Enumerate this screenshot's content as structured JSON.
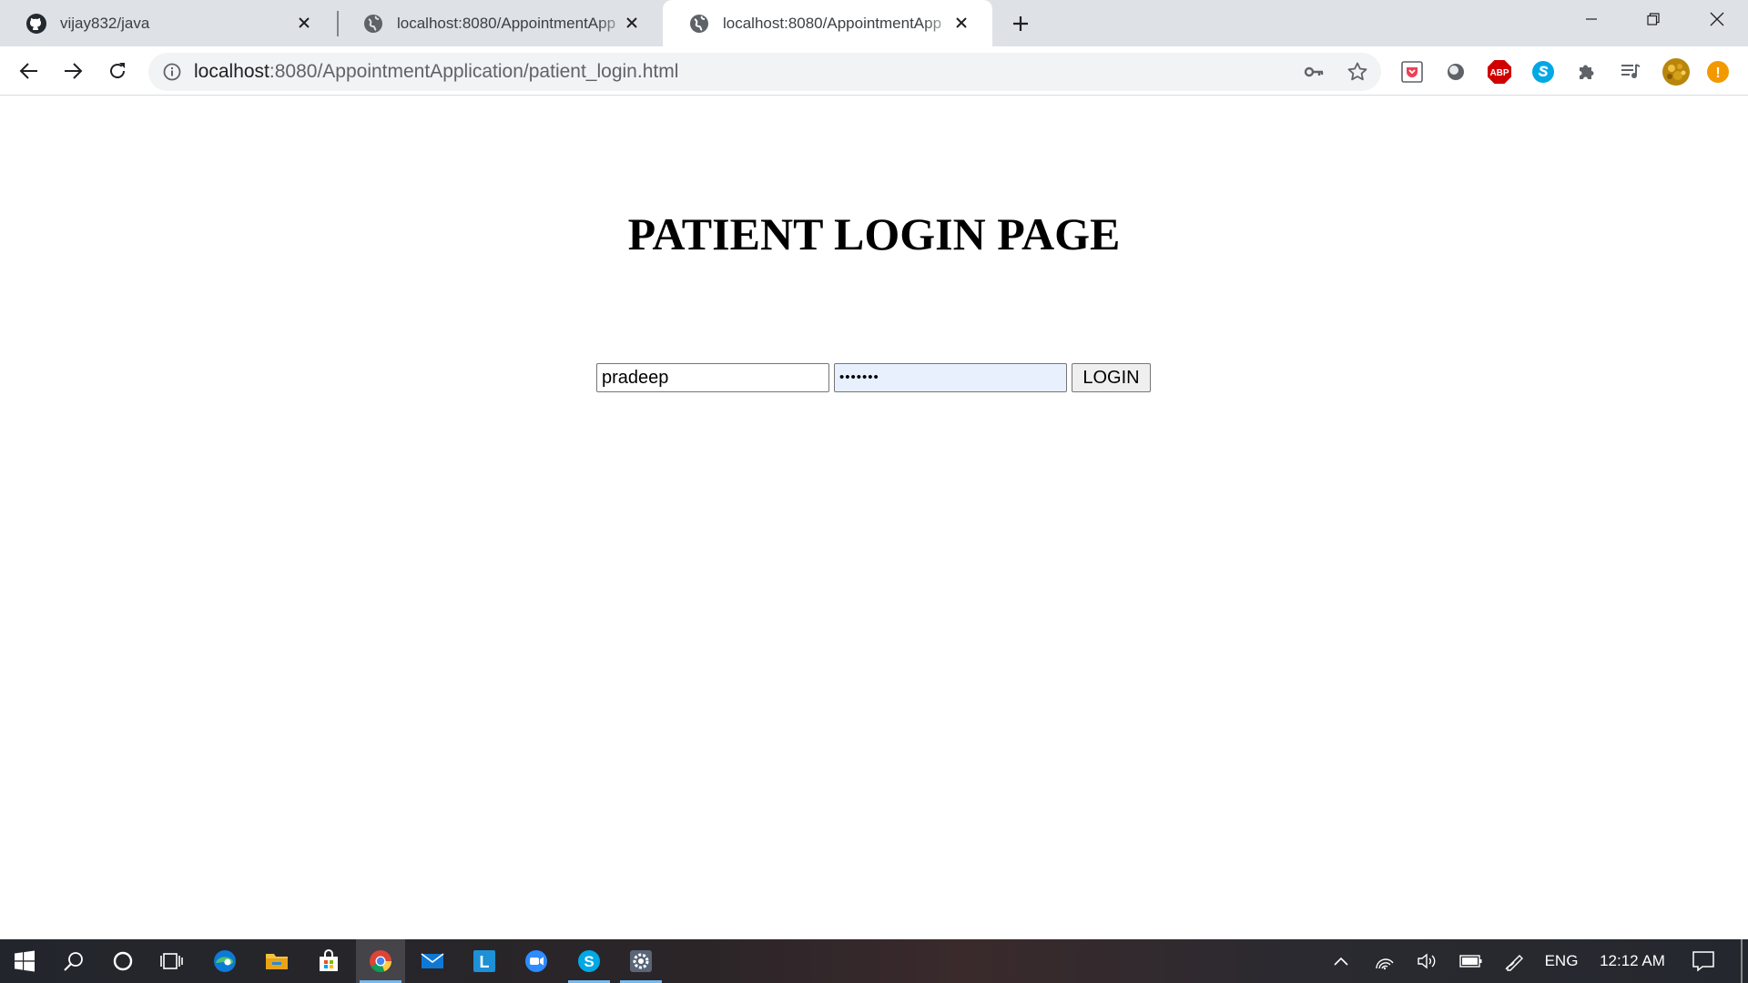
{
  "browser": {
    "tabs": [
      {
        "title": "vijay832/java",
        "icon": "github-icon",
        "active": false
      },
      {
        "title": "localhost:8080/AppointmentApp",
        "icon": "globe-icon",
        "active": false
      },
      {
        "title": "localhost:8080/AppointmentApp",
        "icon": "globe-icon",
        "active": true
      }
    ],
    "url_host": "localhost",
    "url_path": ":8080/AppointmentApplication/patient_login.html",
    "extensions": [
      "pocket-icon",
      "circle-extension-icon",
      "adblock-plus-icon",
      "skype-icon",
      "puzzle-icon",
      "media-control-icon",
      "profile-avatar-icon",
      "update-alert-icon"
    ],
    "adblock_label": "ABP",
    "alert_label": "!"
  },
  "page": {
    "heading": "PATIENT LOGIN PAGE",
    "username_value": "pradeep",
    "password_mask": "•••••••",
    "login_label": "LOGIN"
  },
  "taskbar": {
    "pinned": [
      "windows-start-icon",
      "search-icon",
      "cortana-icon",
      "task-view-icon",
      "edge-icon",
      "file-explorer-icon",
      "store-icon",
      "chrome-icon",
      "mail-icon",
      "l-app-icon",
      "zoom-icon",
      "skype-icon",
      "settings-app-icon"
    ],
    "language": "ENG",
    "time": "12:12 AM",
    "l_app_label": "L",
    "skype_label": "S"
  },
  "colors": {
    "tab_strip": "#dee1e6",
    "password_autofill": "#e8f0fe",
    "abp_red": "#d00000",
    "skype_blue": "#00a8e6",
    "alert_orange": "#f29900"
  }
}
